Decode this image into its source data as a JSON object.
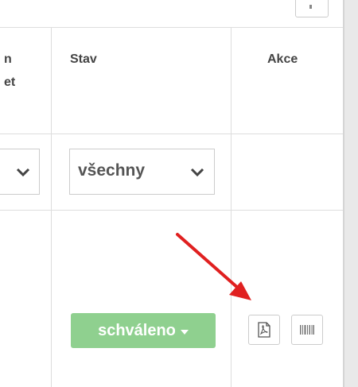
{
  "table": {
    "headers": {
      "partial_col_line1": "n",
      "partial_col_line2": "et",
      "status": "Stav",
      "actions": "Akce"
    },
    "filters": {
      "status_select_value": "všechny"
    },
    "rows": [
      {
        "status_label": "schváleno",
        "actions": [
          "pdf-icon",
          "barcode-icon"
        ]
      }
    ]
  },
  "colors": {
    "status_approved": "#8fd08f",
    "annotation_arrow": "#e02020",
    "grid": "#dddddd"
  }
}
